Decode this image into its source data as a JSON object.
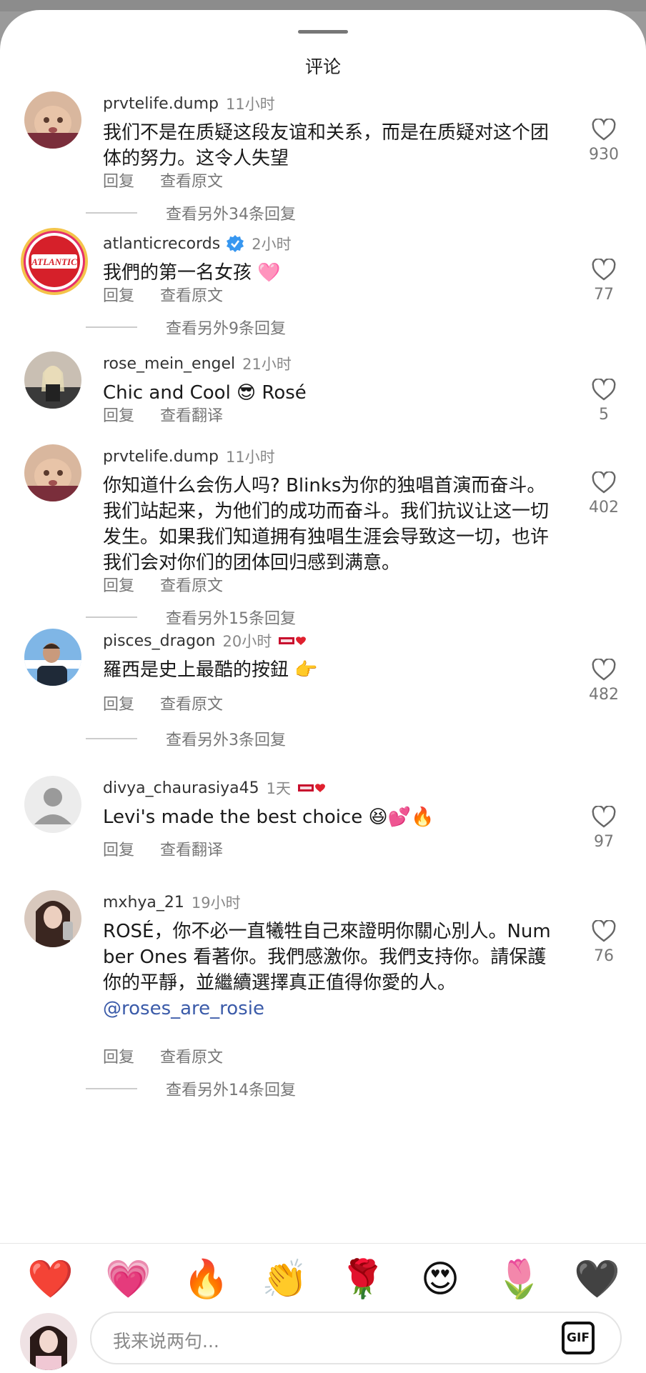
{
  "sheet": {
    "title": "评论"
  },
  "comments": [
    {
      "user": "prvtelife.dump",
      "time": "11小时",
      "text": "我们不是在质疑这段友谊和关系，而是在质疑对这个团体的努力。这令人失望",
      "actions": [
        "回复",
        "查看原文"
      ],
      "likes": "930",
      "more": "查看另外34条回复"
    },
    {
      "user": "atlanticrecords",
      "time": "2小时",
      "text": "我們的第一名女孩 🩷",
      "actions": [
        "回复",
        "查看原文"
      ],
      "likes": "77",
      "more": "查看另外9条回复",
      "logo_text": "ATLANTIC"
    },
    {
      "user": "rose_mein_engel",
      "time": "21小时",
      "text": "Chic and Cool 😎 Rosé",
      "actions": [
        "回复",
        "查看翻译"
      ],
      "likes": "5"
    },
    {
      "user": "prvtelife.dump",
      "time": "11小时",
      "text": "你知道什么会伤人吗? Blinks为你的独唱首演而奋斗。我们站起来，为他们的成功而奋斗。我们抗议让这一切发生。如果我们知道拥有独唱生涯会导致这一切，也许我们会对你们的团体回归感到满意。",
      "actions": [
        "回复",
        "查看原文"
      ],
      "likes": "402",
      "more": "查看另外15条回复"
    },
    {
      "user": "pisces_dragon",
      "time": "20小时",
      "text": "羅西是史上最酷的按鈕 👉",
      "actions": [
        "回复",
        "查看原文"
      ],
      "likes": "482",
      "more": "查看另外3条回复"
    },
    {
      "user": "divya_chaurasiya45",
      "time": "1天",
      "text": "Levi's made the best choice 😆💕🔥",
      "actions": [
        "回复",
        "查看翻译"
      ],
      "likes": "97"
    },
    {
      "user": "mxhya_21",
      "time": "19小时",
      "text": "ROSÉ，你不必一直犧牲自己來證明你關心別人。Number Ones 看著你。我們感激你。我們支持你。請保護你的平靜，並繼續選擇真正值得你愛的人。",
      "mention": "@roses_are_rosie",
      "actions": [
        "回复",
        "查看原文"
      ],
      "likes": "76",
      "more": "查看另外14条回复"
    }
  ],
  "emoji_bar": [
    "❤️",
    "💗",
    "🔥",
    "👏",
    "🌹",
    "😍",
    "🌷",
    "🖤"
  ],
  "composer": {
    "placeholder": "我来说两句...",
    "gif_label": "GIF"
  },
  "colors": {
    "mention": "#3b5ba9",
    "atlantic_red": "#d6202a",
    "verified_blue": "#3797f0"
  },
  "icons": {
    "like": "heart-outline-icon",
    "verified": "verified-badge-icon",
    "levi": "levis-love-badge-icon"
  }
}
